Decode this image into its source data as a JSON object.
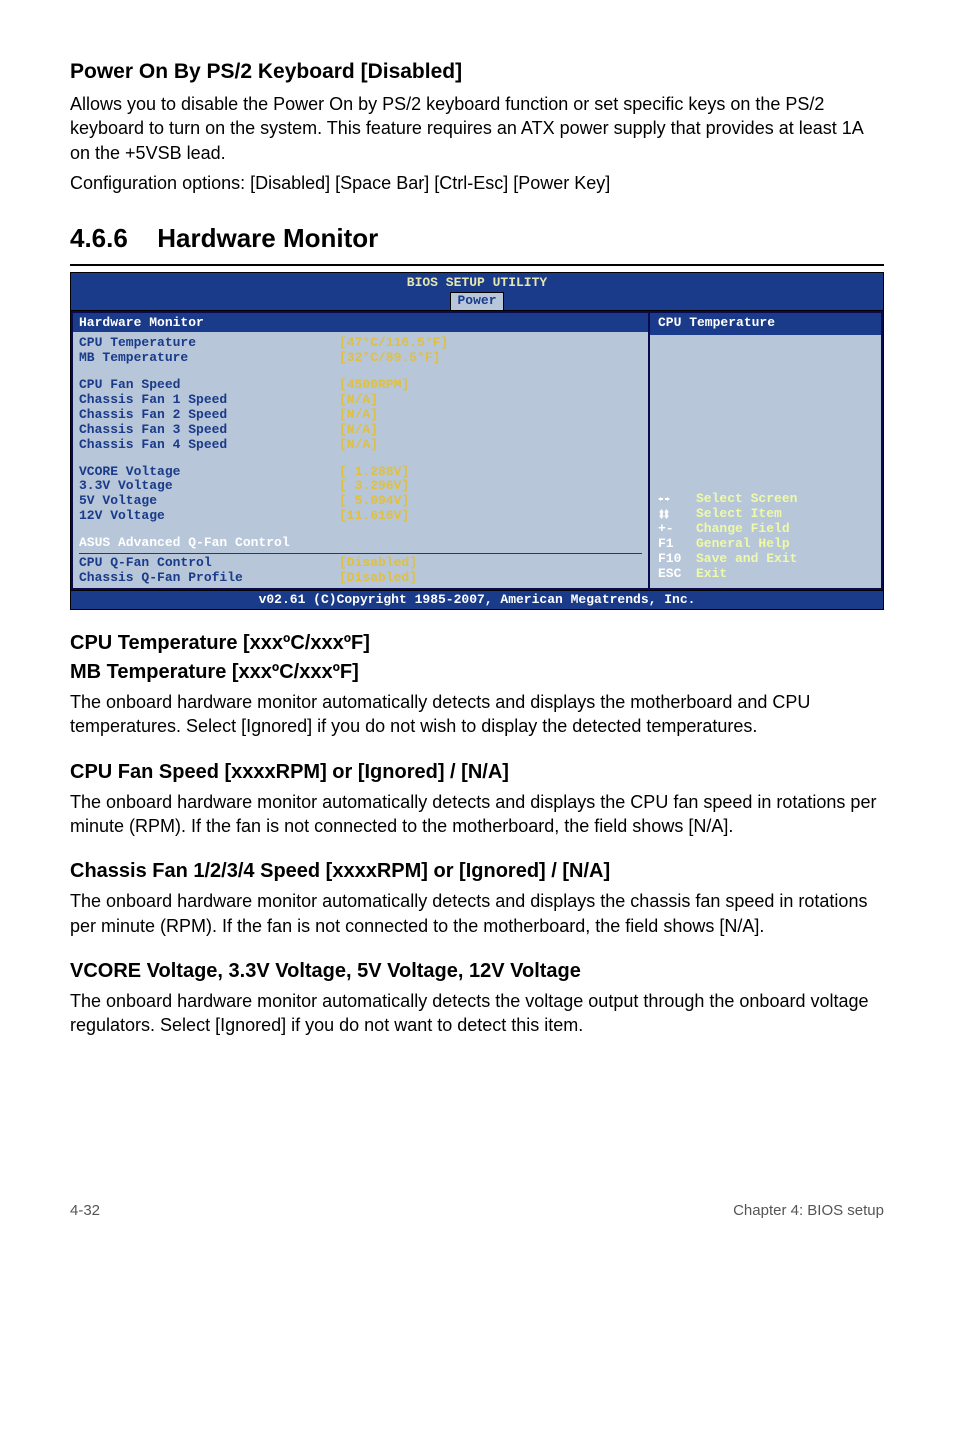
{
  "section1": {
    "title": "Power On By PS/2 Keyboard [Disabled]",
    "p1": "Allows you to disable the Power On by PS/2 keyboard function or set specific keys on the PS/2 keyboard to turn on the system. This feature requires an ATX power supply that provides at least 1A on the +5VSB lead.",
    "p2": "Configuration options: [Disabled] [Space Bar] [Ctrl-Esc] [Power Key]"
  },
  "mainTitle": {
    "num": "4.6.6",
    "text": "Hardware Monitor"
  },
  "bios": {
    "topTitle": "BIOS SETUP UTILITY",
    "tab": "Power",
    "panelTitle": "Hardware Monitor",
    "sidebarTitle": "CPU Temperature",
    "rows": {
      "cpuTempLabel": "CPU Temperature",
      "cpuTempVal": "[47°C/116.5°F]",
      "mbTempLabel": "MB Temperature",
      "mbTempVal": "[32°C/89.5°F]",
      "cpuFanLabel": "CPU Fan Speed",
      "cpuFanVal": "[4500RPM]",
      "cf1Label": "Chassis Fan 1 Speed",
      "cf1Val": "[N/A]",
      "cf2Label": "Chassis Fan 2 Speed",
      "cf2Val": "[N/A]",
      "cf3Label": "Chassis Fan 3 Speed",
      "cf3Val": "[N/A]",
      "cf4Label": "Chassis Fan 4 Speed",
      "cf4Val": "[N/A]",
      "vcoreLabel": "VCORE Voltage",
      "vcoreVal": "[ 1.288V]",
      "v33Label": "3.3V  Voltage",
      "v33Val": "[ 3.296V]",
      "v5Label": "5V    Voltage",
      "v5Val": "[ 5.094V]",
      "v12Label": "12V   Voltage",
      "v12Val": "[11.616V]",
      "qfanAdvLabel": "ASUS Advanced Q-Fan Control",
      "qfanCtrlLabel": "CPU Q-Fan Control",
      "qfanCtrlVal": "[Disabled]",
      "qfanProfLabel": "Chassis Q-Fan Profile",
      "qfanProfVal": "[Disabled]"
    },
    "help": {
      "selectScreen": "Select Screen",
      "selectItem": "Select Item",
      "changeFieldKey": "+-",
      "changeField": "Change Field",
      "generalHelpKey": "F1",
      "generalHelp": "General Help",
      "saveExitKey": "F10",
      "saveExit": "Save and Exit",
      "exitKey": "ESC",
      "exit": "Exit"
    },
    "footer": "v02.61 (C)Copyright 1985-2007, American Megatrends, Inc."
  },
  "cpuTempSection": {
    "title1": "CPU Temperature [xxxºC/xxxºF]",
    "title2": "MB Temperature [xxxºC/xxxºF]",
    "body": "The onboard hardware monitor automatically detects and displays the motherboard and CPU temperatures. Select [Ignored] if you do not wish to display the detected temperatures."
  },
  "cpuFanSection": {
    "title": "CPU Fan Speed [xxxxRPM] or [Ignored] / [N/A]",
    "body": "The onboard hardware monitor automatically detects and displays the CPU fan speed in rotations per minute (RPM). If the fan is not connected to the motherboard, the field shows [N/A]."
  },
  "chassisFanSection": {
    "title": "Chassis Fan 1/2/3/4 Speed [xxxxRPM] or [Ignored] / [N/A]",
    "body": "The onboard hardware monitor automatically detects and displays the chassis fan speed in rotations per minute (RPM). If the fan is not connected to the motherboard, the field shows [N/A]."
  },
  "voltageSection": {
    "title": "VCORE Voltage, 3.3V Voltage, 5V Voltage, 12V Voltage",
    "body": "The onboard hardware monitor automatically detects the voltage output through the onboard voltage regulators. Select [Ignored] if you do not want to detect this item."
  },
  "pageFooter": {
    "left": "4-32",
    "right": "Chapter 4: BIOS setup"
  }
}
